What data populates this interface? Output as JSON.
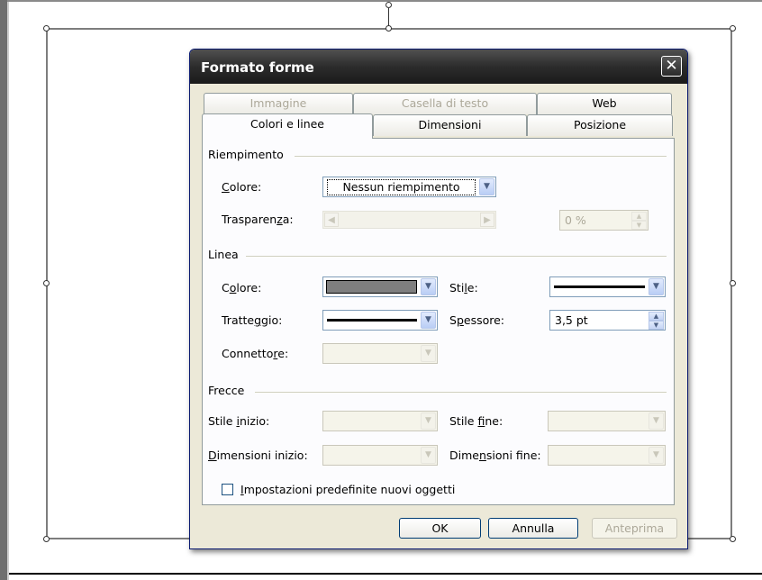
{
  "dialog": {
    "title": "Formato forme",
    "close_glyph": "✕"
  },
  "tabs": {
    "row1": [
      {
        "label": "Immagine",
        "enabled": false
      },
      {
        "label": "Casella di testo",
        "enabled": false
      },
      {
        "label": "Web",
        "enabled": true
      }
    ],
    "row2": [
      {
        "label": "Colori e linee",
        "active": true
      },
      {
        "label": "Dimensioni",
        "active": false
      },
      {
        "label": "Posizione",
        "active": false
      }
    ]
  },
  "fill": {
    "section": "Riempimento",
    "color_label": "Colore:",
    "color_value": "Nessun riempimento",
    "transparency_label": "Trasparenza:",
    "transparency_value": "0 %"
  },
  "line": {
    "section": "Linea",
    "color_label": "Colore:",
    "color_value_hex": "#7f7f7f",
    "style_label": "Stile:",
    "dash_label": "Tratteggio:",
    "weight_label": "Spessore:",
    "weight_value": "3,5 pt",
    "connector_label": "Connettore:"
  },
  "arrows": {
    "section": "Frecce",
    "begin_style_label": "Stile inizio:",
    "end_style_label": "Stile fine:",
    "begin_size_label": "Dimensioni inizio:",
    "end_size_label": "Dimensioni fine:"
  },
  "defaults_checkbox": {
    "label": "Impostazioni predefinite nuovi oggetti",
    "checked": false
  },
  "buttons": {
    "ok": "OK",
    "cancel": "Annulla",
    "preview": "Anteprima"
  }
}
